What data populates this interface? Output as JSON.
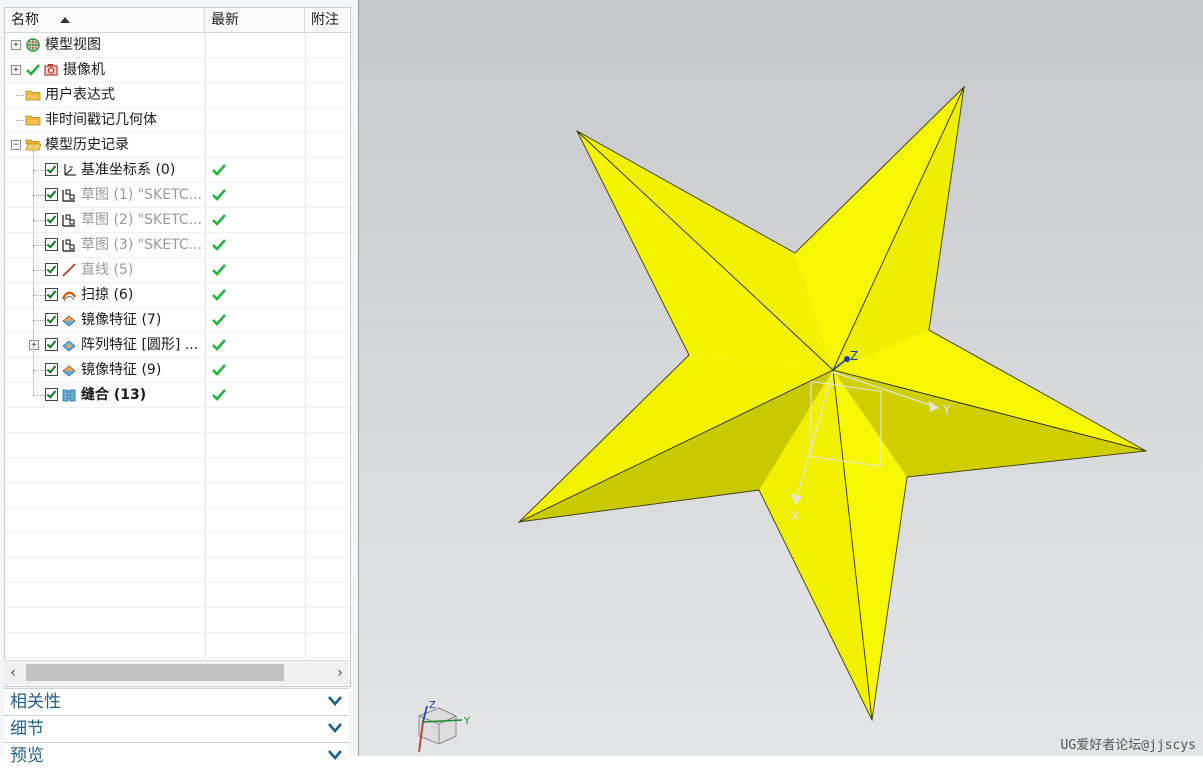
{
  "navigator": {
    "columns": {
      "name": "名称",
      "latest": "最新",
      "note": "附注"
    },
    "rows": [
      {
        "label": "模型视图",
        "icon": "model-views-icon",
        "state": "normal"
      },
      {
        "label": "摄像机",
        "icon": "camera-icon",
        "state": "normal"
      },
      {
        "label": "用户表达式",
        "icon": "folder-icon",
        "state": "normal"
      },
      {
        "label": "非时间戳记几何体",
        "icon": "folder-icon",
        "state": "normal"
      },
      {
        "label": "模型历史记录",
        "icon": "folder-open-icon",
        "state": "normal"
      },
      {
        "label": "基准坐标系 (0)",
        "icon": "datum-csys-icon",
        "state": "normal",
        "latest": "✔"
      },
      {
        "label": "草图 (1) \"SKETC...",
        "icon": "sketch-icon",
        "state": "grey",
        "latest": "✔"
      },
      {
        "label": "草图 (2) \"SKETC...",
        "icon": "sketch-icon",
        "state": "grey",
        "latest": "✔"
      },
      {
        "label": "草图 (3) \"SKETC...",
        "icon": "sketch-icon",
        "state": "grey",
        "latest": "✔"
      },
      {
        "label": "直线 (5)",
        "icon": "line-icon",
        "state": "grey",
        "latest": "✔"
      },
      {
        "label": "扫掠 (6)",
        "icon": "sweep-icon",
        "state": "normal",
        "latest": "✔"
      },
      {
        "label": "镜像特征 (7)",
        "icon": "mirror-feature-icon",
        "state": "normal",
        "latest": "✔"
      },
      {
        "label": "阵列特征 [圆形] ...",
        "icon": "pattern-feature-icon",
        "state": "normal",
        "latest": "✔"
      },
      {
        "label": "镜像特征 (9)",
        "icon": "mirror-feature-icon",
        "state": "normal",
        "latest": "✔"
      },
      {
        "label": "缝合 (13)",
        "icon": "sew-icon",
        "state": "bold",
        "latest": "✔"
      }
    ]
  },
  "panels": {
    "dependencies": "相关性",
    "details": "细节",
    "preview": "预览"
  },
  "viewport": {
    "axis_labels": {
      "z": "Z",
      "y": "Y",
      "x": "X"
    },
    "triad_labels": {
      "z": "Z",
      "y": "Y"
    },
    "watermark": "UG爱好者论坛@jjscys"
  },
  "colors": {
    "star_face": "#f7f700",
    "star_shadow": "#cccc00",
    "check_green": "#1fb53a",
    "panel_label": "#1f5f8b"
  }
}
